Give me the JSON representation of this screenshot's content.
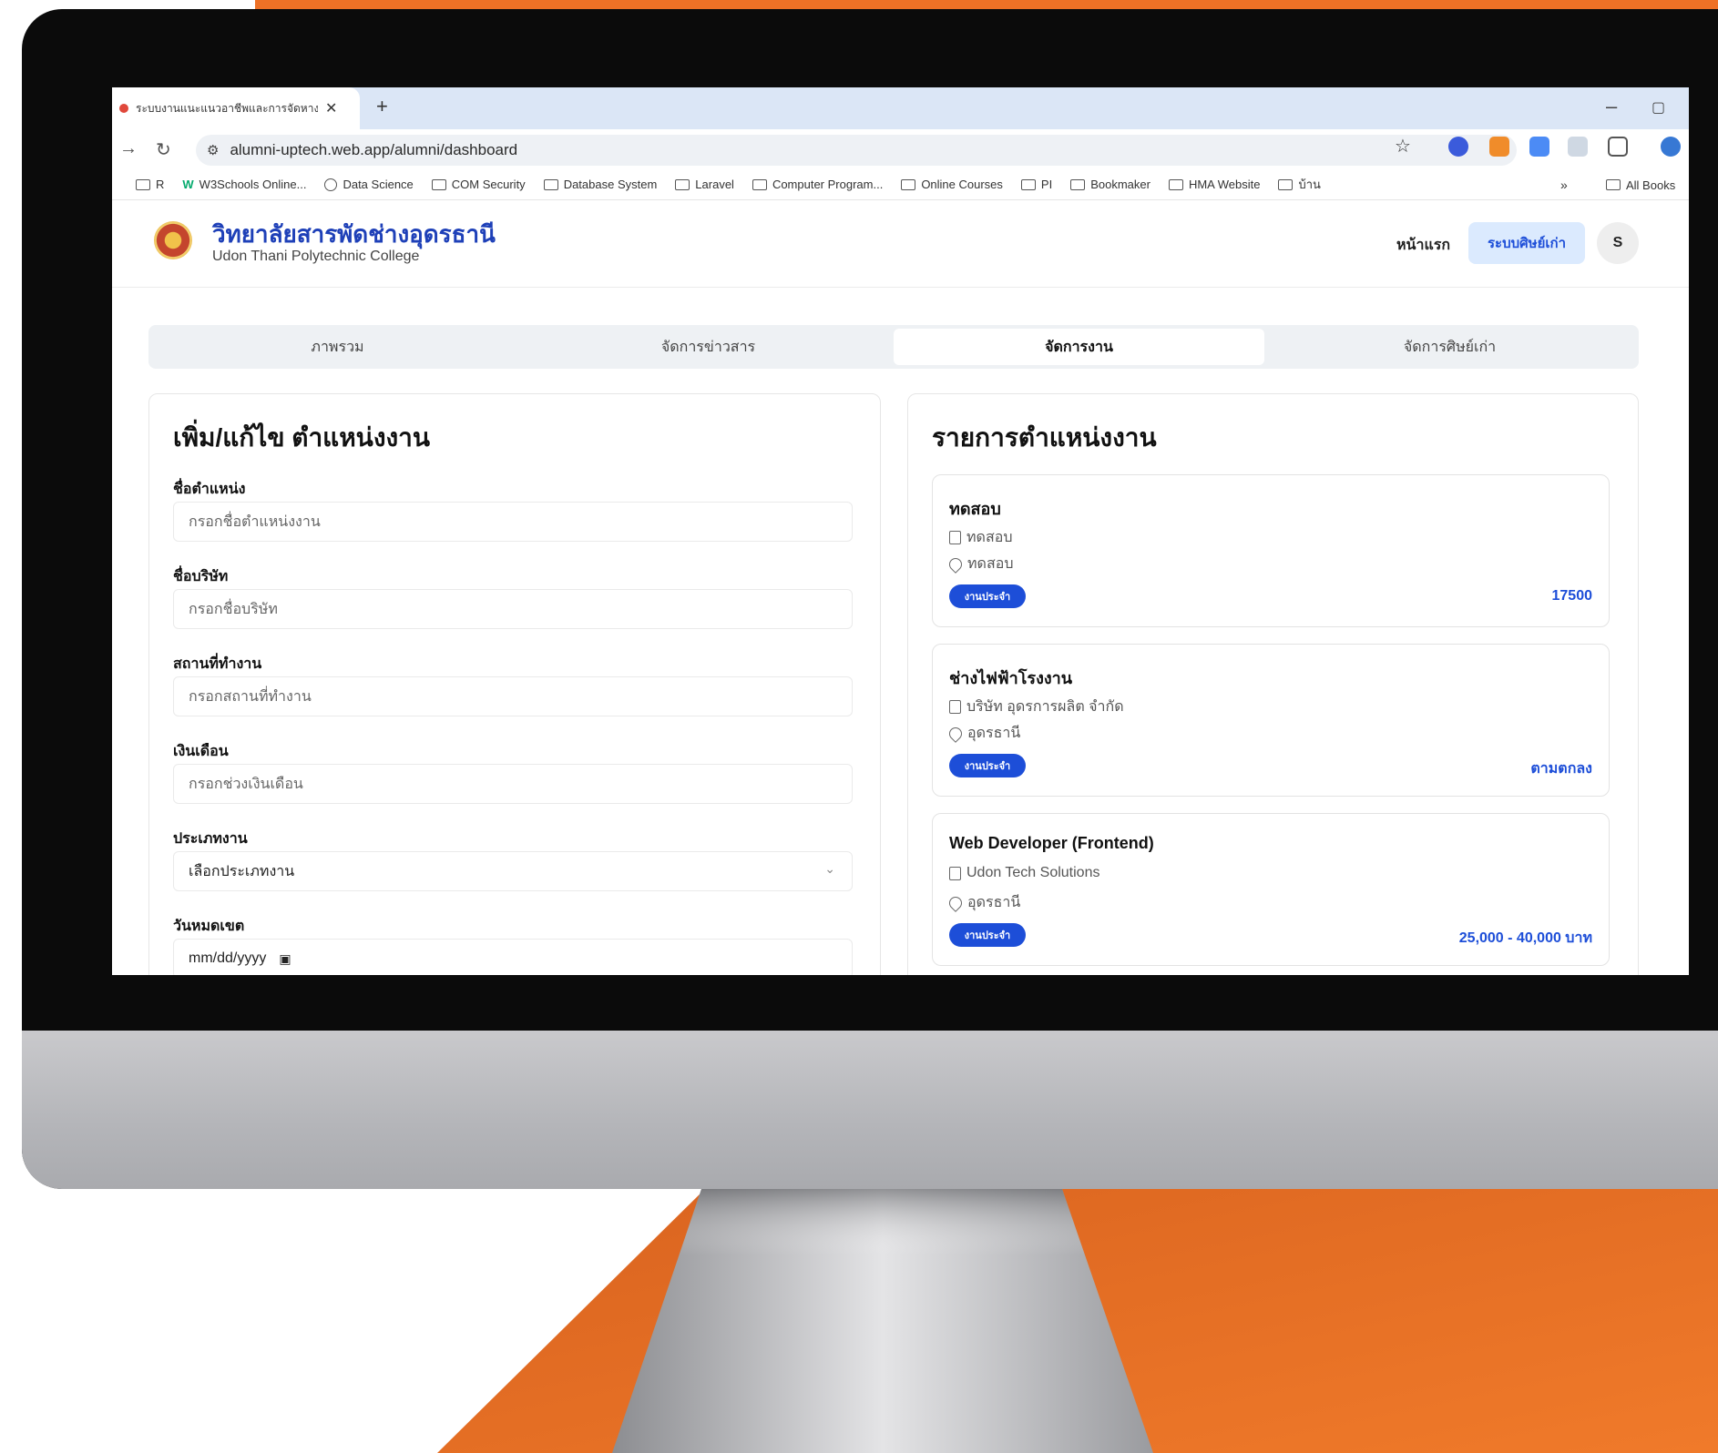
{
  "browser": {
    "tab_title": "ระบบงานแนะแนวอาชีพและการจัดหาง...",
    "url": "alumni-uptech.web.app/alumni/dashboard",
    "bookmarks": [
      "R",
      "W3Schools Online...",
      "Data Science",
      "COM Security",
      "Database System",
      "Laravel",
      "Computer Program...",
      "Online Courses",
      "PI",
      "Bookmaker",
      "HMA Website",
      "บ้าน"
    ],
    "bookmarks_more": "»",
    "all_bookmarks": "All Books"
  },
  "header": {
    "college_th": "วิทยาลัยสารพัดช่างอุดรธานี",
    "college_en": "Udon Thani Polytechnic College",
    "nav_home": "หน้าแรก",
    "nav_alumni": "ระบบศิษย์เก่า",
    "avatar": "S"
  },
  "tabs": [
    {
      "label": "ภาพรวม",
      "active": false
    },
    {
      "label": "จัดการข่าวสาร",
      "active": false
    },
    {
      "label": "จัดการงาน",
      "active": true
    },
    {
      "label": "จัดการศิษย์เก่า",
      "active": false
    }
  ],
  "form": {
    "title": "เพิ่ม/แก้ไข ตำแหน่งงาน",
    "position_label": "ชื่อตำแหน่ง",
    "position_placeholder": "กรอกชื่อตำแหน่งงาน",
    "company_label": "ชื่อบริษัท",
    "company_placeholder": "กรอกชื่อบริษัท",
    "location_label": "สถานที่ทำงาน",
    "location_placeholder": "กรอกสถานที่ทำงาน",
    "salary_label": "เงินเดือน",
    "salary_placeholder": "กรอกช่วงเงินเดือน",
    "type_label": "ประเภทงาน",
    "type_value": "เลือกประเภทงาน",
    "deadline_label": "วันหมดเขต",
    "deadline_placeholder": "mm/dd/yyyy"
  },
  "joblist": {
    "title": "รายการตำแหน่งงาน",
    "jobs": [
      {
        "title": "ทดสอบ",
        "company": "ทดสอบ",
        "location": "ทดสอบ",
        "type": "งานประจำ",
        "salary": "17500"
      },
      {
        "title": "ช่างไฟฟ้าโรงงาน",
        "company": "บริษัท อุดรการผลิต จำกัด",
        "location": "อุดรธานี",
        "type": "งานประจำ",
        "salary": "ตามตกลง"
      },
      {
        "title": "Web Developer (Frontend)",
        "company": "Udon Tech Solutions",
        "location": "อุดรธานี",
        "type": "งานประจำ",
        "salary": "25,000 - 40,000 บาท"
      }
    ]
  },
  "colors": {
    "brand_orange": "#ee7126",
    "accent_blue": "#1d4ed8"
  }
}
